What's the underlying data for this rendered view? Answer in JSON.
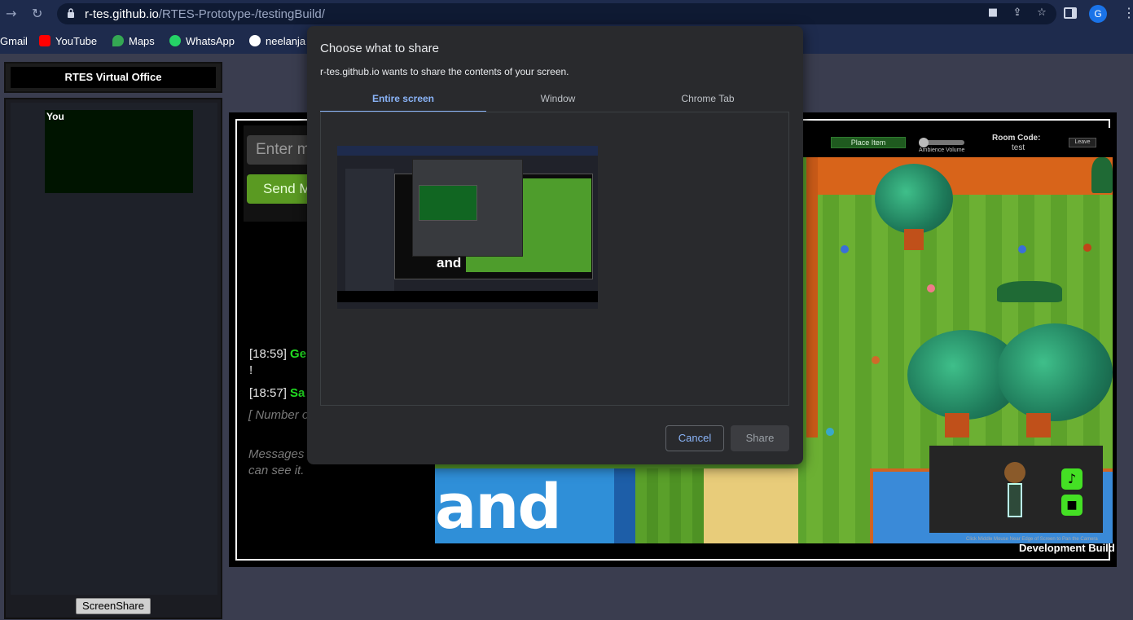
{
  "browser": {
    "url_host": "r-tes.github.io",
    "url_path": "/RTES-Prototype-/testingBuild/",
    "profile_initial": "G",
    "bookmarks": [
      {
        "label": "Gmail",
        "color": "#ea4335"
      },
      {
        "label": "YouTube",
        "color": "#ff0000"
      },
      {
        "label": "Maps",
        "color": "#34a853"
      },
      {
        "label": "WhatsApp",
        "color": "#25d366"
      },
      {
        "label": "neelanja",
        "color": "#ffffff"
      }
    ]
  },
  "office": {
    "title": "RTES Virtual Office",
    "you_label": "You",
    "screenshare_label": "ScreenShare"
  },
  "chat": {
    "input_placeholder": "Enter me",
    "send_label": "Send Me",
    "messages": [
      {
        "time": "[18:59]",
        "name": "Ge",
        "continuation": "!"
      },
      {
        "time": "[18:57]",
        "name": "Sa"
      }
    ],
    "system_room": "[ Number o room: 3 ]",
    "system_saved": "Messages saved. Everyone can see it."
  },
  "game": {
    "place_item_label": "Place Item",
    "ambience_label": "Ambience Volume",
    "room_code_label": "Room Code:",
    "room_code": "test",
    "leave_label": "Leave",
    "land_text": "and",
    "hint": "Click Middle Mouse Near Edge of Screen to Pan the Camera",
    "dev_build": "Development Build"
  },
  "dialog": {
    "title": "Choose what to share",
    "subtitle": "r-tes.github.io wants to share the contents of your screen.",
    "tabs": [
      "Entire screen",
      "Window",
      "Chrome Tab"
    ],
    "active_tab": "Entire screen",
    "cancel_label": "Cancel",
    "share_label": "Share",
    "accent_color": "#8ab4f8"
  },
  "icons": [
    "back-arrow-icon",
    "reload-icon",
    "lock-icon",
    "camera-icon",
    "share-icon",
    "star-icon",
    "side-panel-icon",
    "mic-icon",
    "video-camera-icon"
  ]
}
